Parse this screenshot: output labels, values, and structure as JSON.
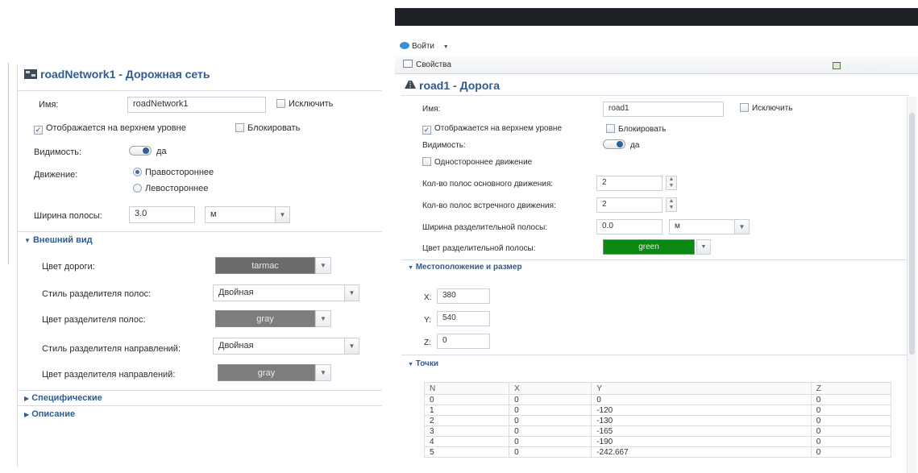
{
  "left": {
    "title": "roadNetwork1 - Дорожная сеть",
    "name_label": "Имя:",
    "name_value": "roadNetwork1",
    "exclude_label": "Исключить",
    "top_level_label": "Отображается на верхнем уровне",
    "lock_label": "Блокировать",
    "visibility_label": "Видимость:",
    "visibility_value": "да",
    "traffic_label": "Движение:",
    "traffic_right": "Правостороннее",
    "traffic_left": "Левостороннее",
    "lane_width_label": "Ширина полосы:",
    "lane_width_value": "3.0",
    "lane_width_unit": "м",
    "appearance_header": "Внешний вид",
    "road_color_label": "Цвет дороги:",
    "road_color_value": "tarmac",
    "lane_sep_style_label": "Стиль разделителя полос:",
    "lane_sep_style_value": "Двойная",
    "lane_sep_color_label": "Цвет разделителя полос:",
    "lane_sep_color_value": "gray",
    "dir_sep_style_label": "Стиль разделителя направлений:",
    "dir_sep_style_value": "Двойная",
    "dir_sep_color_label": "Цвет разделителя направлений:",
    "dir_sep_color_value": "gray",
    "specific_header": "Специфические",
    "description_header": "Описание"
  },
  "right": {
    "login_label": "Войти",
    "properties_tab": "Свойства",
    "title": "road1 - Дорога",
    "name_label": "Имя:",
    "name_value": "road1",
    "exclude_label": "Исключить",
    "top_level_label": "Отображается на верхнем уровне",
    "lock_label": "Блокировать",
    "visibility_label": "Видимость:",
    "visibility_value": "да",
    "one_way_label": "Одностороннее движение",
    "main_lanes_label": "Кол-во полос основного движения:",
    "main_lanes_value": "2",
    "opposite_lanes_label": "Кол-во полос встречного движения:",
    "opposite_lanes_value": "2",
    "median_width_label": "Ширина разделительной полосы:",
    "median_width_value": "0.0",
    "median_width_unit": "м",
    "median_color_label": "Цвет разделительной полосы:",
    "median_color_value": "green",
    "location_header": "Местоположение и размер",
    "x_label": "X:",
    "x_value": "380",
    "y_label": "Y:",
    "y_value": "540",
    "z_label": "Z:",
    "z_value": "0",
    "points_header": "Точки",
    "points": {
      "columns": [
        "N",
        "X",
        "Y",
        "Z"
      ],
      "rows": [
        [
          "0",
          "0",
          "0",
          "0"
        ],
        [
          "1",
          "0",
          "-120",
          "0"
        ],
        [
          "2",
          "0",
          "-130",
          "0"
        ],
        [
          "3",
          "0",
          "-165",
          "0"
        ],
        [
          "4",
          "0",
          "-190",
          "0"
        ],
        [
          "5",
          "0",
          "-242.667",
          "0"
        ]
      ]
    }
  },
  "colors": {
    "tarmac": "#6b6b6b",
    "gray": "#7d7d7d",
    "green": "#0a8a12",
    "header_blue": "#2f5b8f",
    "top_bar": "#1e2126"
  }
}
